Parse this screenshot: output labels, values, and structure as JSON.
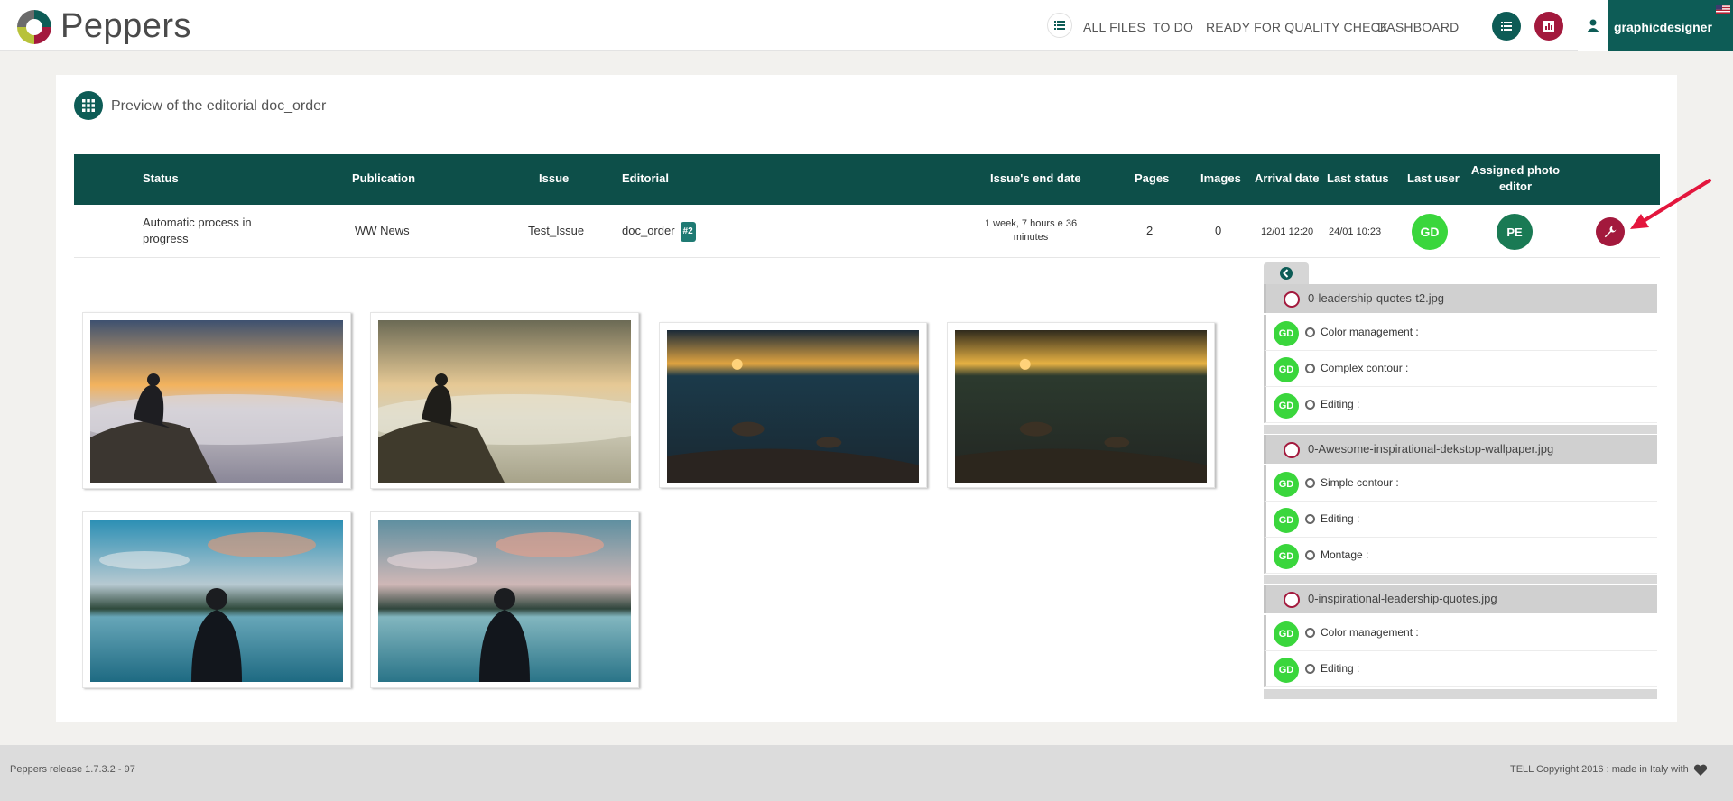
{
  "header": {
    "brand": "Peppers",
    "nav": [
      "ALL FILES",
      "TO DO",
      "READY FOR QUALITY CHECK",
      "DASHBOARD"
    ],
    "username": "graphicdesigner",
    "icons": [
      "list-icon",
      "bar-chart-icon",
      "user-icon",
      "flag-icon"
    ],
    "colors": {
      "teal": "#0d5c56",
      "crimson": "#a3193d",
      "green": "#3ad63c"
    }
  },
  "page": {
    "title": "Preview of the editorial doc_order"
  },
  "table": {
    "headers": {
      "status": "Status",
      "publication": "Publication",
      "issue": "Issue",
      "editorial": "Editorial",
      "end_date": "Issue's end date",
      "pages": "Pages",
      "images": "Images",
      "arrival": "Arrival date",
      "last_status": "Last status",
      "last_user": "Last user",
      "assigned_line1": "Assigned photo",
      "assigned_line2": "editor"
    },
    "row": {
      "status_line1": "Automatic process in",
      "status_line2": "progress",
      "publication": "WW News",
      "issue": "Test_Issue",
      "editorial": "doc_order",
      "editorial_badge": "#2",
      "end_date_line1": "1 week, 7 hours e 36",
      "end_date_line2": "minutes",
      "pages": "2",
      "images": "0",
      "arrival": "12/01 12:20",
      "last_status": "24/01 10:23",
      "last_user": "GD",
      "assigned": "PE"
    }
  },
  "side_panel": {
    "files": [
      {
        "name": "0-leadership-quotes-t2.jpg",
        "tasks": [
          {
            "user": "GD",
            "label": "Color management :"
          },
          {
            "user": "GD",
            "label": "Complex contour :"
          },
          {
            "user": "GD",
            "label": "Editing :"
          }
        ]
      },
      {
        "name": "0-Awesome-inspirational-dekstop-wallpaper.jpg",
        "tasks": [
          {
            "user": "GD",
            "label": "Simple contour :"
          },
          {
            "user": "GD",
            "label": "Editing :"
          },
          {
            "user": "GD",
            "label": "Montage :"
          }
        ]
      },
      {
        "name": "0-inspirational-leadership-quotes.jpg",
        "tasks": [
          {
            "user": "GD",
            "label": "Color management :"
          },
          {
            "user": "GD",
            "label": "Editing :"
          }
        ]
      }
    ]
  },
  "footer": {
    "release": "Peppers release 1.7.3.2 - 97",
    "copyright": "TELL Copyright 2016 : made in Italy with"
  }
}
